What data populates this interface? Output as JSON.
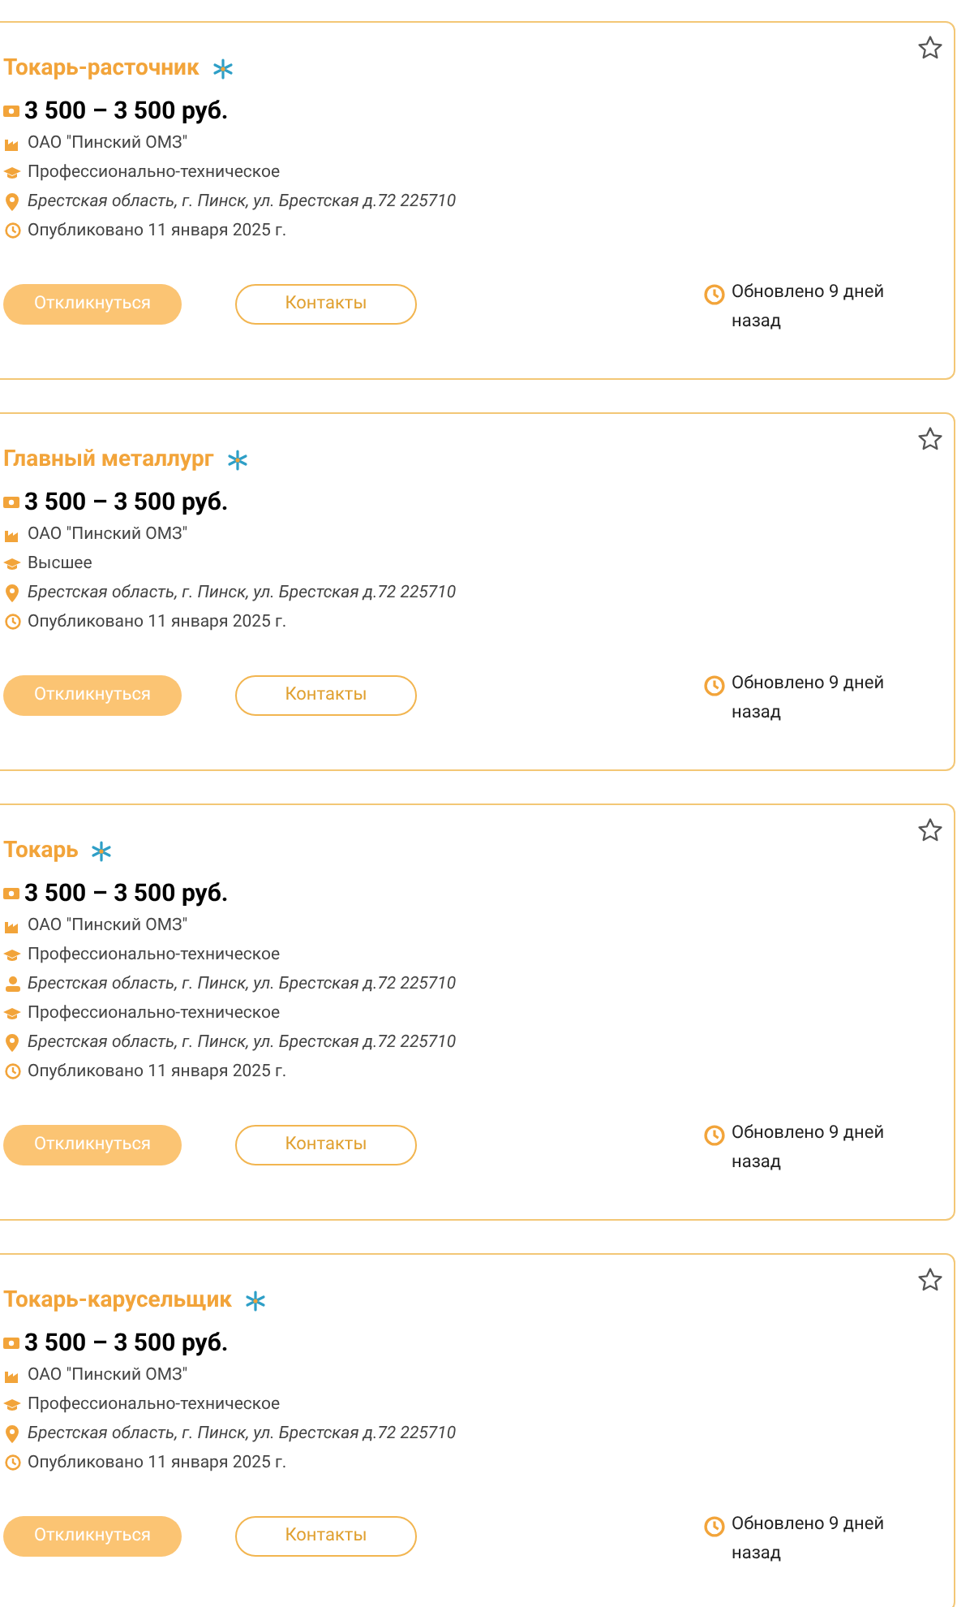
{
  "vacancies": [
    {
      "title": "Токарь-расточник",
      "salary": "3 500 – 3 500 руб.",
      "rows": [
        {
          "kind": "company",
          "text": "ОАО \"Пинский ОМЗ\""
        },
        {
          "kind": "education",
          "text": "Профессионально-техническое"
        },
        {
          "kind": "address",
          "text": "Брестская область, г. Пинск, ул. Брестская д.72 225710"
        },
        {
          "kind": "published",
          "text": "Опубликовано 11 января 2025 г."
        }
      ],
      "apply": "Откликнуться",
      "contacts": "Контакты",
      "updated": "Обновлено 9 дней назад"
    },
    {
      "title": "Главный металлург",
      "salary": "3 500 – 3 500 руб.",
      "rows": [
        {
          "kind": "company",
          "text": "ОАО \"Пинский ОМЗ\""
        },
        {
          "kind": "education",
          "text": "Высшее"
        },
        {
          "kind": "address",
          "text": "Брестская область, г. Пинск, ул. Брестская д.72 225710"
        },
        {
          "kind": "published",
          "text": "Опубликовано 11 января 2025 г."
        }
      ],
      "apply": "Откликнуться",
      "contacts": "Контакты",
      "updated": "Обновлено 9 дней назад"
    },
    {
      "title": "Токарь",
      "salary": "3 500 – 3 500 руб.",
      "rows": [
        {
          "kind": "company",
          "text": "ОАО \"Пинский ОМЗ\""
        },
        {
          "kind": "education",
          "text": "Профессионально-техническое"
        },
        {
          "kind": "person",
          "text": "Брестская область, г. Пинск, ул. Брестская д.72 225710"
        },
        {
          "kind": "education",
          "text": "Профессионально-техническое"
        },
        {
          "kind": "address",
          "text": "Брестская область, г. Пинск, ул. Брестская д.72 225710"
        },
        {
          "kind": "published",
          "text": "Опубликовано 11 января 2025 г."
        }
      ],
      "apply": "Откликнуться",
      "contacts": "Контакты",
      "updated": "Обновлено 9 дней назад"
    },
    {
      "title": "Токарь-карусельщик",
      "salary": "3 500 – 3 500 руб.",
      "rows": [
        {
          "kind": "company",
          "text": "ОАО \"Пинский ОМЗ\""
        },
        {
          "kind": "education",
          "text": "Профессионально-техническое"
        },
        {
          "kind": "address",
          "text": "Брестская область, г. Пинск, ул. Брестская д.72 225710"
        },
        {
          "kind": "published",
          "text": "Опубликовано 11 января 2025 г."
        }
      ],
      "apply": "Откликнуться",
      "contacts": "Контакты",
      "updated": "Обновлено 9 дней назад"
    }
  ]
}
